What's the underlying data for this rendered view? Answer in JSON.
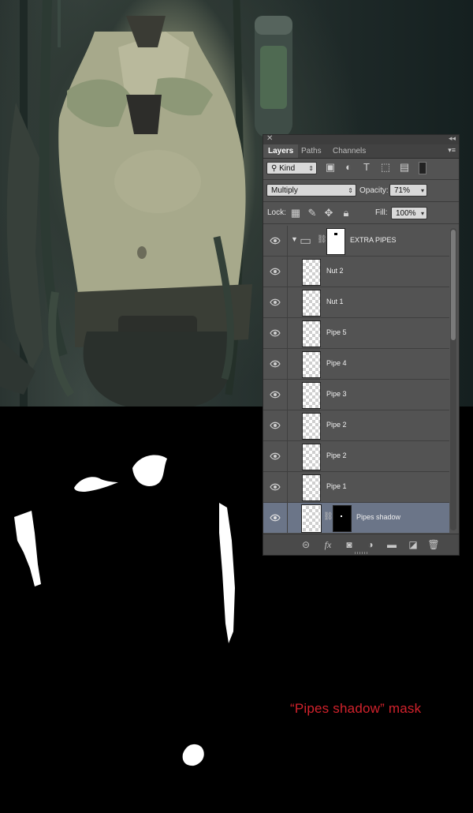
{
  "tabs": [
    {
      "label": "Layers",
      "active": true
    },
    {
      "label": "Paths",
      "active": false
    },
    {
      "label": "Channels",
      "active": false
    }
  ],
  "filter": {
    "kind_label": "Kind",
    "icons": [
      "image-filter-icon",
      "adjustment-filter-icon",
      "type-filter-icon",
      "shape-filter-icon",
      "smart-object-filter-icon",
      "filter-toggle"
    ]
  },
  "blend": {
    "mode": "Multiply",
    "opacity_label": "Opacity:",
    "opacity_value": "71%"
  },
  "lock": {
    "label": "Lock:",
    "icons": [
      "lock-transparent-icon",
      "lock-image-icon",
      "lock-position-icon",
      "lock-all-icon"
    ],
    "fill_label": "Fill:",
    "fill_value": "100%"
  },
  "layers": [
    {
      "name": "EXTRA PIPES",
      "type": "group",
      "selected": false
    },
    {
      "name": "Nut 2",
      "type": "layer",
      "selected": false
    },
    {
      "name": "Nut 1",
      "type": "layer",
      "selected": false
    },
    {
      "name": "Pipe 5",
      "type": "layer",
      "selected": false
    },
    {
      "name": "Pipe 4",
      "type": "layer",
      "selected": false
    },
    {
      "name": "Pipe 3",
      "type": "layer",
      "selected": false
    },
    {
      "name": "Pipe 2",
      "type": "layer",
      "selected": false
    },
    {
      "name": "Pipe 2",
      "type": "layer",
      "selected": false
    },
    {
      "name": "Pipe 1",
      "type": "layer",
      "selected": false
    },
    {
      "name": "Pipes shadow",
      "type": "masked-layer",
      "selected": true
    }
  ],
  "bottom_icons": [
    "link-layers-icon",
    "fx-icon",
    "add-mask-icon",
    "adjustment-layer-icon",
    "new-group-icon",
    "new-layer-icon",
    "trash-icon"
  ],
  "mask_caption": "“Pipes shadow” mask",
  "colors": {
    "panel_bg": "#535353",
    "selected_row": "#6b7588",
    "caption_red": "#d3222c"
  }
}
